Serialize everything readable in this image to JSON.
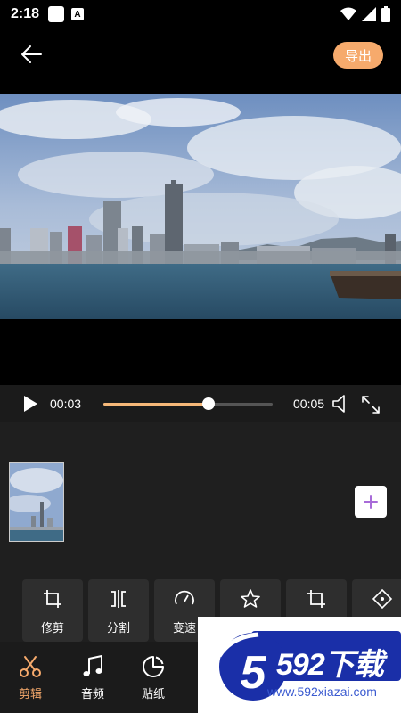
{
  "status_bar": {
    "time": "2:18",
    "badge": "A"
  },
  "header": {
    "export_label": "导出"
  },
  "player": {
    "current_time": "00:03",
    "total_time": "00:05",
    "progress": 0.62
  },
  "tools": [
    {
      "label": "修剪",
      "icon": "crop-icon"
    },
    {
      "label": "分割",
      "icon": "split-icon"
    },
    {
      "label": "变速",
      "icon": "speedometer-icon"
    },
    {
      "label": "",
      "icon": "star-icon"
    },
    {
      "label": "",
      "icon": "crop-icon"
    },
    {
      "label": "",
      "icon": "diamond-icon"
    }
  ],
  "nav": [
    {
      "label": "剪辑",
      "icon": "scissors-icon",
      "active": true
    },
    {
      "label": "音频",
      "icon": "music-note-icon",
      "active": false
    },
    {
      "label": "贴纸",
      "icon": "sticker-icon",
      "active": false
    }
  ],
  "watermark": {
    "brand": "592下载",
    "url": "www.592xiazai.com",
    "logo_digit": "5"
  },
  "colors": {
    "accent": "#f6aa6c",
    "panel": "#1f1f1f",
    "tool_bg": "#2e2e2e"
  }
}
